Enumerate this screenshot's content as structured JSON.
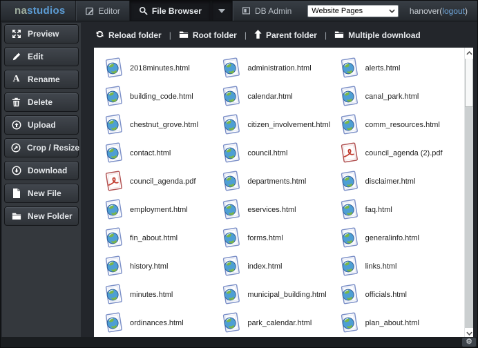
{
  "topbar": {
    "logo": {
      "part1": "na",
      "part2": "studios"
    },
    "editor_label": "Editor",
    "file_browser_label": "File Browser",
    "db_admin_label": "DB Admin",
    "page_select": {
      "value": "Website Pages"
    },
    "user": {
      "name": "hanover",
      "paren_open": " (",
      "logout_label": "logout",
      "paren_close": ")"
    }
  },
  "sidebar": {
    "items": [
      {
        "label": "Preview",
        "icon": "expand-icon"
      },
      {
        "label": "Edit",
        "icon": "pencil-icon"
      },
      {
        "label": "Rename",
        "icon": "letter-a-icon"
      },
      {
        "label": "Delete",
        "icon": "trash-icon"
      },
      {
        "label": "Upload",
        "icon": "upload-circle-icon"
      },
      {
        "label": "Crop / Resize",
        "icon": "resize-circle-icon"
      },
      {
        "label": "Download",
        "icon": "download-circle-icon"
      },
      {
        "label": "New File",
        "icon": "new-file-icon"
      },
      {
        "label": "New Folder",
        "icon": "folder-icon"
      }
    ]
  },
  "toolbar": {
    "separator": "|",
    "items": [
      {
        "label": "Reload folder",
        "icon": "refresh-icon"
      },
      {
        "label": "Root folder",
        "icon": "folder-icon"
      },
      {
        "label": "Parent folder",
        "icon": "arrow-up-icon"
      },
      {
        "label": "Multiple download",
        "icon": "folder-icon"
      }
    ]
  },
  "files": [
    {
      "name": "2018minutes.html",
      "type": "html"
    },
    {
      "name": "administration.html",
      "type": "html"
    },
    {
      "name": "alerts.html",
      "type": "html"
    },
    {
      "name": "building_code.html",
      "type": "html"
    },
    {
      "name": "calendar.html",
      "type": "html"
    },
    {
      "name": "canal_park.html",
      "type": "html"
    },
    {
      "name": "chestnut_grove.html",
      "type": "html"
    },
    {
      "name": "citizen_involvement.html",
      "type": "html"
    },
    {
      "name": "comm_resources.html",
      "type": "html"
    },
    {
      "name": "contact.html",
      "type": "html"
    },
    {
      "name": "council.html",
      "type": "html"
    },
    {
      "name": "council_agenda (2).pdf",
      "type": "pdf"
    },
    {
      "name": "council_agenda.pdf",
      "type": "pdf"
    },
    {
      "name": "departments.html",
      "type": "html"
    },
    {
      "name": "disclaimer.html",
      "type": "html"
    },
    {
      "name": "employment.html",
      "type": "html"
    },
    {
      "name": "eservices.html",
      "type": "html"
    },
    {
      "name": "faq.html",
      "type": "html"
    },
    {
      "name": "fin_about.html",
      "type": "html"
    },
    {
      "name": "forms.html",
      "type": "html"
    },
    {
      "name": "generalinfo.html",
      "type": "html"
    },
    {
      "name": "history.html",
      "type": "html"
    },
    {
      "name": "index.html",
      "type": "html"
    },
    {
      "name": "links.html",
      "type": "html"
    },
    {
      "name": "minutes.html",
      "type": "html"
    },
    {
      "name": "municipal_building.html",
      "type": "html"
    },
    {
      "name": "officials.html",
      "type": "html"
    },
    {
      "name": "ordinances.html",
      "type": "html"
    },
    {
      "name": "park_calendar.html",
      "type": "html"
    },
    {
      "name": "plan_about.html",
      "type": "html"
    }
  ],
  "icon_glyphs": {
    "rename": "A",
    "gear": "⚙"
  },
  "colors": {
    "accent_blue": "#5b9bd3",
    "logo_gray_green": "#9fae9f",
    "html_icon_blue": "#7b8fc7",
    "pdf_icon_red": "#b05050",
    "topbar_dark": "#24282d",
    "sidebar_panel": "#34383d",
    "link_blue": "#6ea4d8"
  }
}
